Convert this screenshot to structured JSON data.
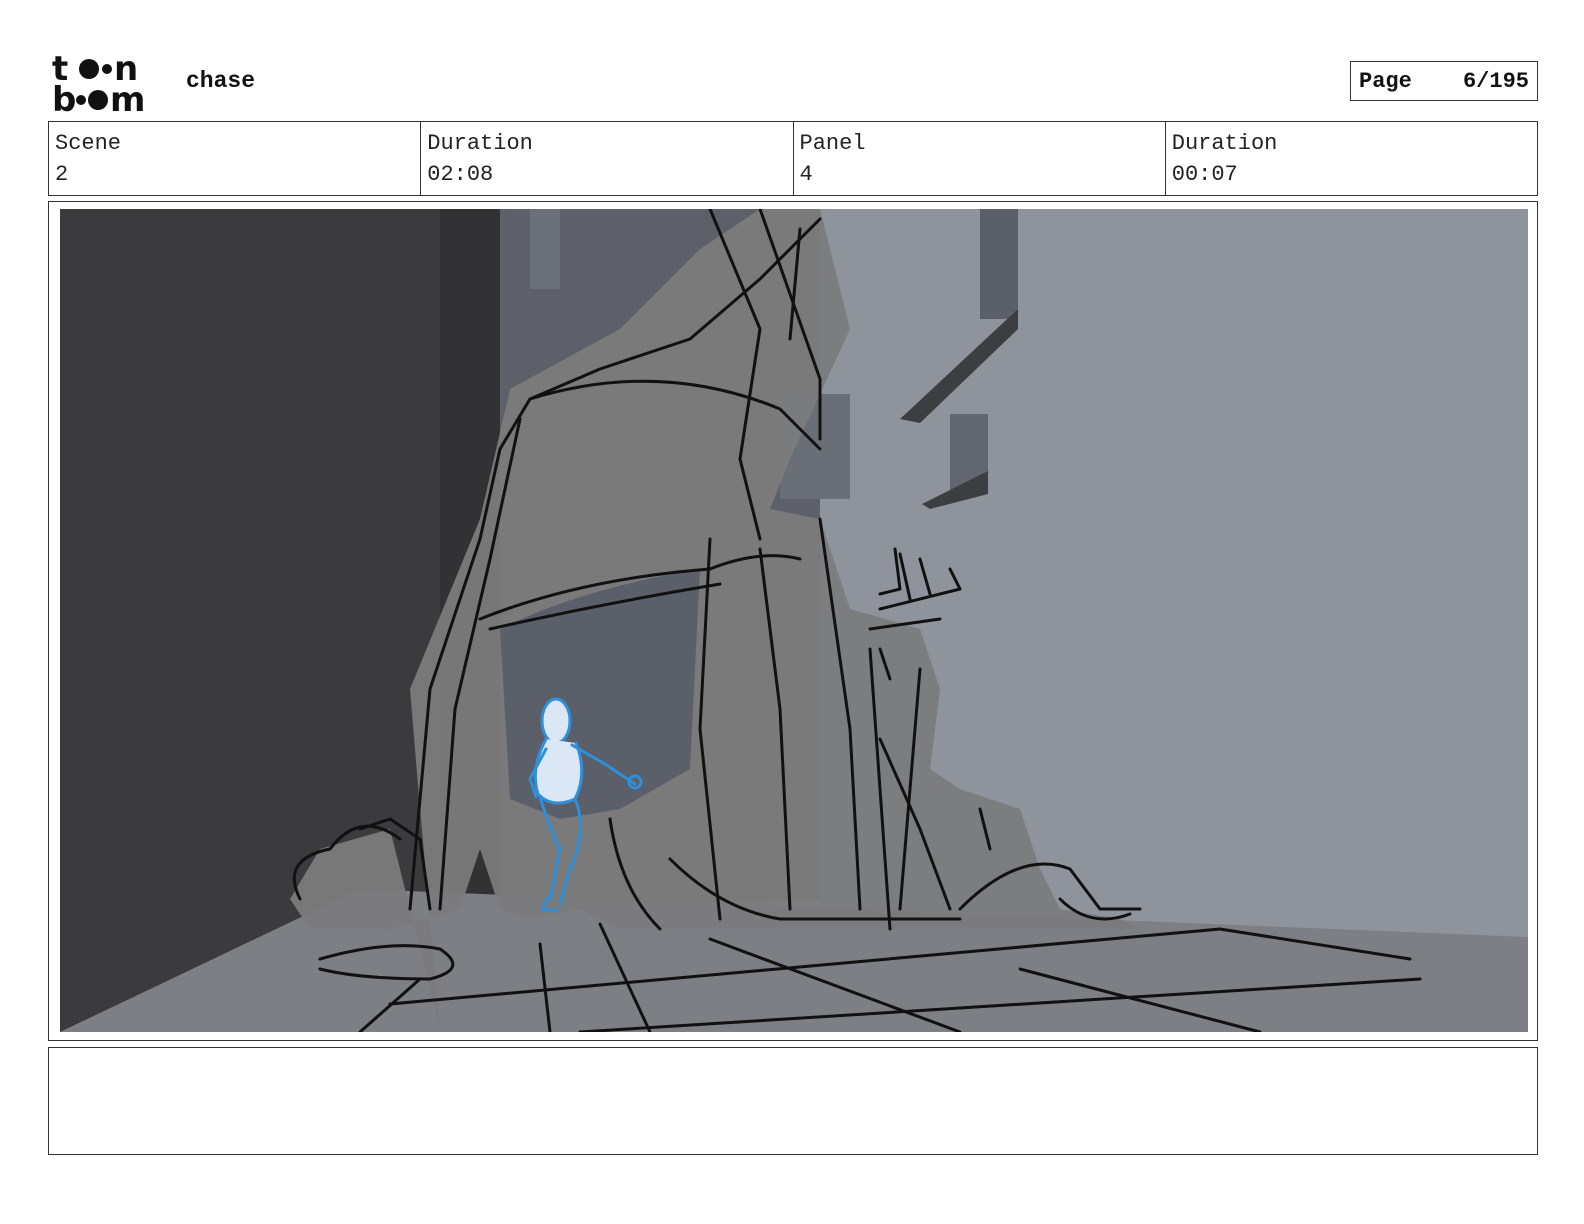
{
  "header": {
    "logo": {
      "name": "toon boom",
      "icon": "toon-boom-logo"
    },
    "title": "chase",
    "page": {
      "label": "Page",
      "value": "6/195"
    }
  },
  "info": [
    {
      "label": "Scene",
      "value": "2"
    },
    {
      "label": "Duration",
      "value": "02:08"
    },
    {
      "label": "Panel",
      "value": "4"
    },
    {
      "label": "Duration",
      "value": "00:07"
    }
  ],
  "panel": {
    "image": "storyboard-sketch-character-running-through-rubble-arch"
  },
  "notes": {
    "text": ""
  },
  "colors": {
    "sketch_blue": "#2f8fd8",
    "wall_dark": "#3a3a3c",
    "wall_light": "#8e939c",
    "floor": "#7d7f85"
  }
}
